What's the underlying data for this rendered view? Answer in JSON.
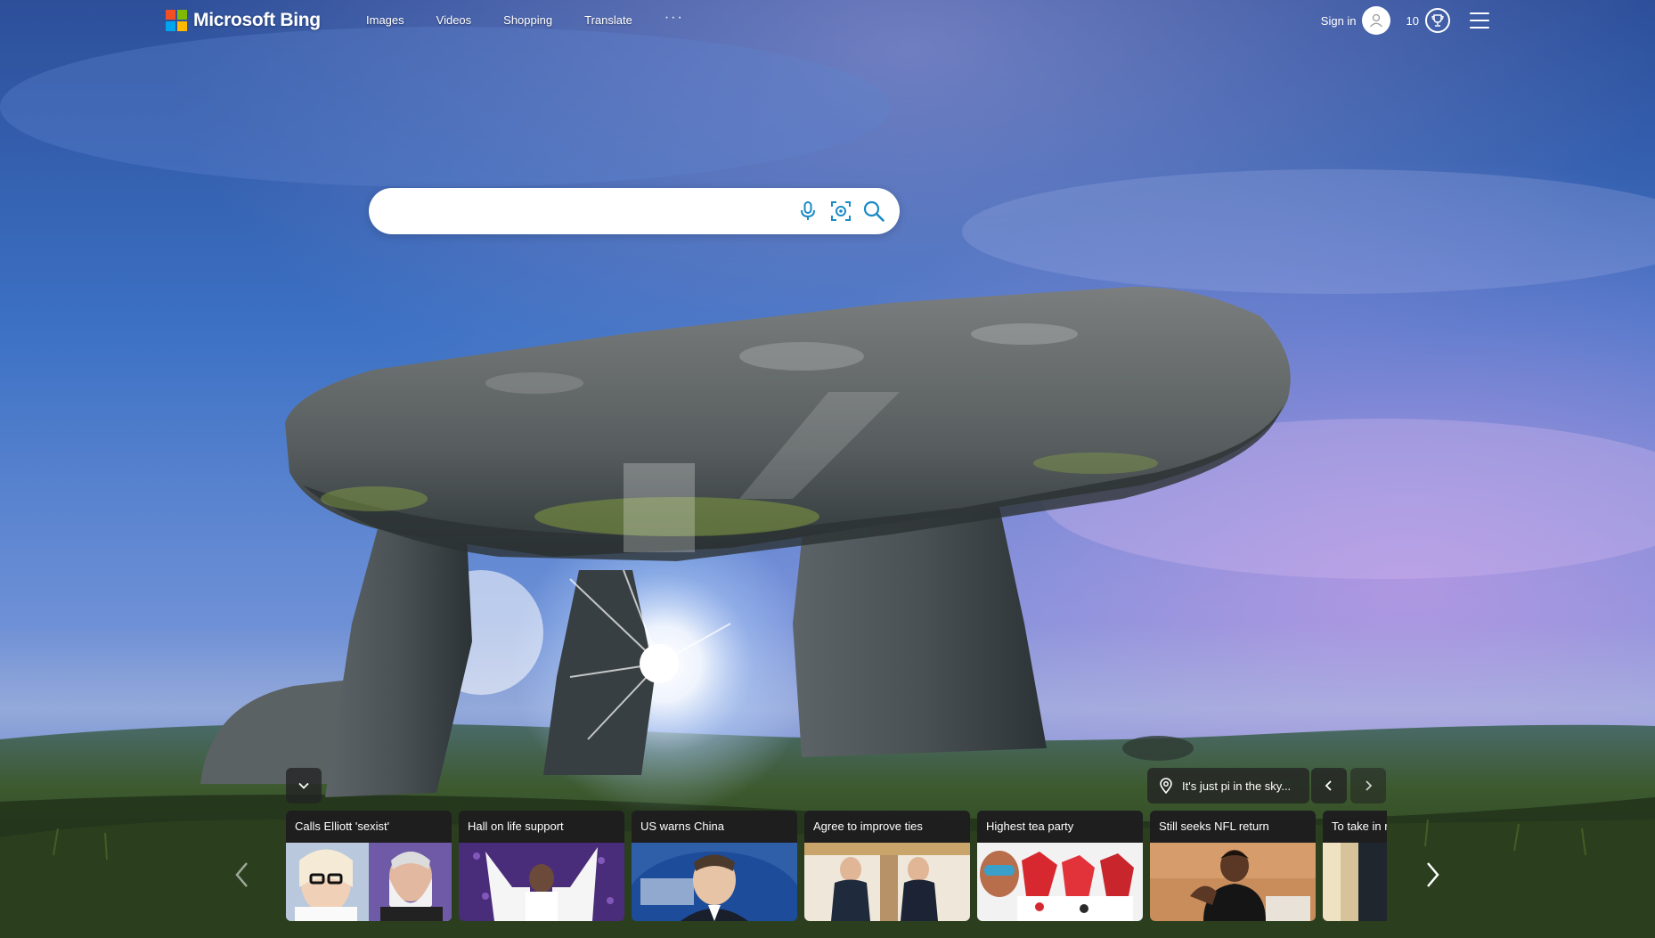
{
  "brand": {
    "name": "Microsoft Bing",
    "logo_colors": [
      "#f25022",
      "#7fba00",
      "#00a4ef",
      "#ffb900"
    ]
  },
  "nav": {
    "items": [
      {
        "label": "Images"
      },
      {
        "label": "Videos"
      },
      {
        "label": "Shopping"
      },
      {
        "label": "Translate"
      }
    ],
    "more_label": "···"
  },
  "header_right": {
    "signin_label": "Sign in",
    "rewards_points": "10",
    "icons": [
      "user-avatar-icon",
      "rewards-trophy-icon",
      "hamburger-menu-icon"
    ]
  },
  "search": {
    "value": "",
    "placeholder": "",
    "icons": [
      "microphone-icon",
      "visual-search-icon",
      "search-icon"
    ],
    "accent_color": "#1a8ac7"
  },
  "image_of_the_day": {
    "info_text": "It's just pi in the sky...",
    "icons": [
      "location-pin-icon",
      "chevron-left-icon",
      "chevron-right-icon"
    ]
  },
  "news_carousel": {
    "collapse_icon": "chevron-down-icon",
    "cards": [
      {
        "title": "Calls Elliott 'sexist'"
      },
      {
        "title": "Hall on life support"
      },
      {
        "title": "US warns China"
      },
      {
        "title": "Agree to improve ties"
      },
      {
        "title": "Highest tea party"
      },
      {
        "title": "Still seeks NFL return"
      },
      {
        "title": "To take in r"
      }
    ],
    "nav_icons": [
      "carousel-prev-icon",
      "carousel-next-icon"
    ]
  }
}
